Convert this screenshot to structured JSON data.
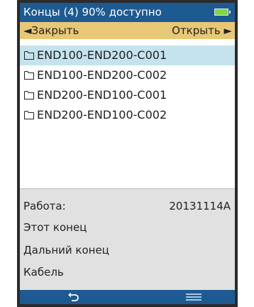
{
  "header": {
    "title": "Концы (4) 90% доступно",
    "battery_icon": "battery-icon",
    "battery_color": "#7fd64a"
  },
  "softkeys": {
    "left_label": "◄Закрыть",
    "right_label": "Открыть ►"
  },
  "list": {
    "selected_index": 0,
    "items": [
      {
        "label": "END100-END200-C001",
        "icon": "folder-icon"
      },
      {
        "label": "END100-END200-C002",
        "icon": "folder-icon"
      },
      {
        "label": "END200-END100-C001",
        "icon": "folder-icon"
      },
      {
        "label": "END200-END100-C002",
        "icon": "folder-icon"
      }
    ]
  },
  "info": {
    "job_label": "Работа:",
    "job_value": "20131114A",
    "this_end_label": "Этот конец",
    "far_end_label": "Дальний конец",
    "cable_label": "Кабель"
  },
  "bottom": {
    "back_icon": "back-arrow-icon",
    "menu_icon": "menu-icon"
  },
  "colors": {
    "title_bar": "#1d5a91",
    "softkey_bar": "#e8c776",
    "selected_row": "#c5e3ee",
    "info_panel": "#e1e1e1"
  }
}
